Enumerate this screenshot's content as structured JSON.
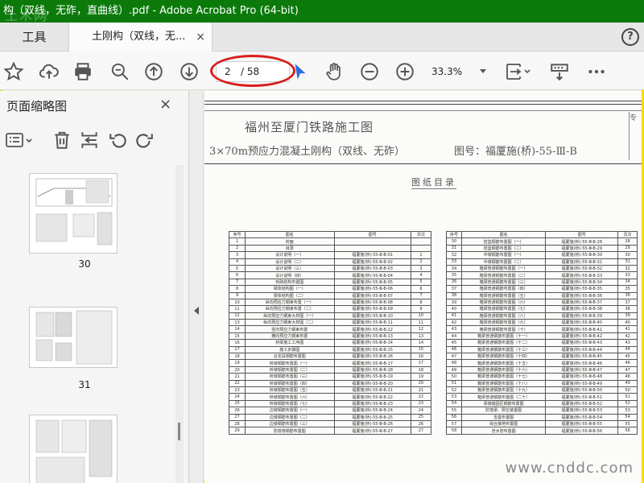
{
  "window": {
    "title": "构（双线，无砟，直曲线）.pdf - Adobe Acrobat Pro (64-bit)",
    "watermark": "土木网"
  },
  "tabs": {
    "tools_label": "工具",
    "document_label": "土刚构（双线，无...",
    "close_glyph": "×",
    "help_glyph": "?"
  },
  "toolbar": {
    "icons": [
      "star-icon",
      "cloud-upload-icon",
      "print-icon",
      "zoom-search-icon",
      "arrow-up-circle-icon",
      "arrow-down-circle-icon",
      "cursor-icon",
      "hand-icon",
      "minus-circle-icon",
      "plus-circle-icon",
      "fit-page-icon",
      "scroll-mode-icon",
      "more-icon"
    ],
    "page_current": "2",
    "page_total": "/ 58",
    "zoom_level": "33.3%",
    "annotation_color": "#d81e1e"
  },
  "sidebar": {
    "title": "页面缩略图",
    "close_glyph": "×",
    "thumbnails": [
      {
        "label": "30"
      },
      {
        "label": "31"
      },
      {
        "label": ""
      }
    ]
  },
  "document": {
    "project_title": "福州至厦门铁路施工图",
    "structure_title": "3×70m预应力混凝土刚构（双线、无砟）",
    "drawing_number": "图号：福厦施(桥)-55-Ⅲ-B",
    "index_title": "图纸目录",
    "side_note": "专",
    "watermark": "www.cnddc.com",
    "left_table_header": [
      "序号",
      "图名",
      "图号",
      "页次"
    ],
    "right_table_header": [
      "序号",
      "图名",
      "图号",
      "页次"
    ],
    "left_table_rows": [
      [
        "1",
        "封面",
        "",
        ""
      ],
      [
        "2",
        "目录",
        "",
        ""
      ],
      [
        "3",
        "设计说明（一）",
        "福厦施(桥)-55-Ⅲ-B-01",
        "1"
      ],
      [
        "4",
        "设计说明（二）",
        "福厦施(桥)-55-Ⅲ-B-02",
        "2"
      ],
      [
        "5",
        "设计说明（三）",
        "福厦施(桥)-55-Ⅲ-B-03",
        "3"
      ],
      [
        "6",
        "设计说明（四）",
        "福厦施(桥)-55-Ⅲ-B-04",
        "4"
      ],
      [
        "7",
        "桥跨结构布置图",
        "福厦施(桥)-55-Ⅲ-B-05",
        "5"
      ],
      [
        "8",
        "梁体结构图（一）",
        "福厦施(桥)-55-Ⅲ-B-06",
        "6"
      ],
      [
        "9",
        "梁体结构图（二）",
        "福厦施(桥)-55-Ⅲ-B-07",
        "7"
      ],
      [
        "10",
        "纵向预应力钢束布置（一）",
        "福厦施(桥)-55-Ⅲ-B-08",
        "8"
      ],
      [
        "11",
        "纵向预应力钢束布置（二）",
        "福厦施(桥)-55-Ⅲ-B-09",
        "9"
      ],
      [
        "12",
        "纵向预应力钢束大样图（一）",
        "福厦施(桥)-55-Ⅲ-B-10",
        "10"
      ],
      [
        "13",
        "纵向预应力钢束大样图（二）",
        "福厦施(桥)-55-Ⅲ-B-11",
        "11"
      ],
      [
        "14",
        "竖向预应力钢束布置",
        "福厦施(桥)-55-Ⅲ-B-12",
        "12"
      ],
      [
        "15",
        "横向预应力钢束布置",
        "福厦施(桥)-55-Ⅲ-B-13",
        "13"
      ],
      [
        "16",
        "桥梁施工工序图",
        "福厦施(桥)-55-Ⅲ-B-14",
        "14"
      ],
      [
        "17",
        "施工步骤图",
        "福厦施(桥)-55-Ⅲ-B-15",
        "15"
      ],
      [
        "18",
        "合龙段钢筋布置图",
        "福厦施(桥)-55-Ⅲ-B-16",
        "16"
      ],
      [
        "19",
        "桥墩钢筋布置图（一）",
        "福厦施(桥)-55-Ⅲ-B-17",
        "17"
      ],
      [
        "20",
        "桥墩钢筋布置图（二）",
        "福厦施(桥)-55-Ⅲ-B-18",
        "18"
      ],
      [
        "21",
        "桥墩钢筋布置图（三）",
        "福厦施(桥)-55-Ⅲ-B-19",
        "19"
      ],
      [
        "22",
        "桥墩钢筋布置图（四）",
        "福厦施(桥)-55-Ⅲ-B-20",
        "20"
      ],
      [
        "23",
        "桥墩钢筋布置图（五）",
        "福厦施(桥)-55-Ⅲ-B-21",
        "21"
      ],
      [
        "24",
        "桥墩钢筋布置图（六）",
        "福厦施(桥)-55-Ⅲ-B-22",
        "22"
      ],
      [
        "25",
        "桥墩钢筋布置图（七）",
        "福厦施(桥)-55-Ⅲ-B-23",
        "23"
      ],
      [
        "26",
        "边墩钢筋布置图（一）",
        "福厦施(桥)-55-Ⅲ-B-24",
        "24"
      ],
      [
        "27",
        "边墩钢筋布置图（二）",
        "福厦施(桥)-55-Ⅲ-B-25",
        "25"
      ],
      [
        "28",
        "边墩钢筋布置图（三）",
        "福厦施(桥)-55-Ⅲ-B-26",
        "26"
      ],
      [
        "29",
        "防撞墙钢筋布置图",
        "福厦施(桥)-55-Ⅲ-B-27",
        "27"
      ]
    ],
    "right_table_rows": [
      [
        "30",
        "挂篮钢筋布置图（一）",
        "福厦施(桥)-55-Ⅲ-B-28",
        "28"
      ],
      [
        "31",
        "挂篮钢筋布置图（二）",
        "福厦施(桥)-55-Ⅲ-B-29",
        "29"
      ],
      [
        "32",
        "中墩钢筋布置图（一）",
        "福厦施(桥)-55-Ⅲ-B-30",
        "30"
      ],
      [
        "33",
        "中墩钢筋布置图（二）",
        "福厦施(桥)-55-Ⅲ-B-31",
        "31"
      ],
      [
        "34",
        "箱梁普通钢筋布置图（一）",
        "福厦施(桥)-55-Ⅲ-B-32",
        "32"
      ],
      [
        "35",
        "箱梁普通钢筋布置图（二）",
        "福厦施(桥)-55-Ⅲ-B-33",
        "33"
      ],
      [
        "36",
        "箱梁普通钢筋布置图（三）",
        "福厦施(桥)-55-Ⅲ-B-34",
        "34"
      ],
      [
        "37",
        "箱梁普通钢筋布置图（四）",
        "福厦施(桥)-55-Ⅲ-B-35",
        "35"
      ],
      [
        "38",
        "箱梁普通钢筋布置图（五）",
        "福厦施(桥)-55-Ⅲ-B-36",
        "36"
      ],
      [
        "39",
        "箱梁普通钢筋布置图（六）",
        "福厦施(桥)-55-Ⅲ-B-37",
        "37"
      ],
      [
        "40",
        "箱梁普通钢筋布置图（七）",
        "福厦施(桥)-55-Ⅲ-B-38",
        "38"
      ],
      [
        "41",
        "箱梁普通钢筋布置图（八）",
        "福厦施(桥)-55-Ⅲ-B-39",
        "39"
      ],
      [
        "42",
        "箱梁普通钢筋布置图（九）",
        "福厦施(桥)-55-Ⅲ-B-40",
        "40"
      ],
      [
        "43",
        "箱梁普通钢筋布置图（十）",
        "福厦施(桥)-55-Ⅲ-B-41",
        "41"
      ],
      [
        "44",
        "箱梁普通钢筋布置图（十一）",
        "福厦施(桥)-55-Ⅲ-B-42",
        "42"
      ],
      [
        "45",
        "箱梁普通钢筋布置图（十二）",
        "福厦施(桥)-55-Ⅲ-B-43",
        "43"
      ],
      [
        "46",
        "箱梁普通钢筋布置图（十三）",
        "福厦施(桥)-55-Ⅲ-B-44",
        "44"
      ],
      [
        "47",
        "箱梁普通钢筋布置图（十四）",
        "福厦施(桥)-55-Ⅲ-B-45",
        "45"
      ],
      [
        "48",
        "箱梁普通钢筋布置图（十五）",
        "福厦施(桥)-55-Ⅲ-B-46",
        "46"
      ],
      [
        "49",
        "箱梁普通钢筋布置图（十六）",
        "福厦施(桥)-55-Ⅲ-B-47",
        "47"
      ],
      [
        "50",
        "箱梁普通钢筋布置图（十七）",
        "福厦施(桥)-55-Ⅲ-B-48",
        "48"
      ],
      [
        "51",
        "箱梁普通钢筋布置图（十八）",
        "福厦施(桥)-55-Ⅲ-B-49",
        "49"
      ],
      [
        "52",
        "箱梁普通钢筋布置图（十九）",
        "福厦施(桥)-55-Ⅲ-B-50",
        "50"
      ],
      [
        "53",
        "箱梁普通钢筋布置图（二十）",
        "福厦施(桥)-55-Ⅲ-B-51",
        "51"
      ],
      [
        "54",
        "梁端锚固区钢筋布置图",
        "福厦施(桥)-55-Ⅲ-B-52",
        "52"
      ],
      [
        "55",
        "防落梁、限位装置图",
        "福厦施(桥)-55-Ⅲ-B-53",
        "53"
      ],
      [
        "56",
        "支座布置图",
        "福厦施(桥)-55-Ⅲ-B-54",
        "54"
      ],
      [
        "57",
        "综合接地布置图",
        "福厦施(桥)-55-Ⅲ-B-55",
        "55"
      ],
      [
        "58",
        "泄水管布置图",
        "福厦施(桥)-55-Ⅲ-B-56",
        "56"
      ]
    ]
  }
}
